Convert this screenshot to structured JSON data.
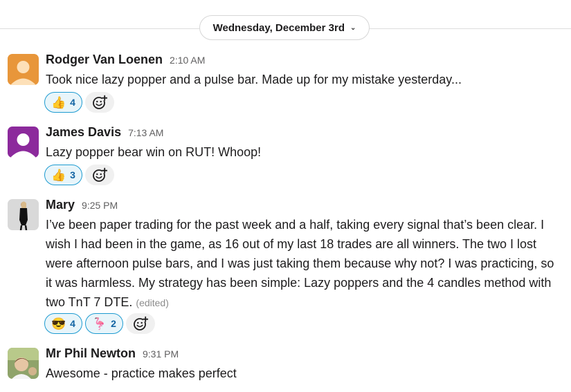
{
  "date_divider": {
    "label": "Wednesday, December 3rd"
  },
  "messages": [
    {
      "author": "Rodger Van Loenen",
      "time": "2:10 AM",
      "text": "Took nice lazy popper and a pulse bar. Made up for my mistake yesterday...",
      "reactions": [
        {
          "emoji": "👍",
          "count": "4"
        }
      ]
    },
    {
      "author": "James Davis",
      "time": "7:13 AM",
      "text": "Lazy popper bear win on RUT! Whoop!",
      "reactions": [
        {
          "emoji": "👍",
          "count": "3"
        }
      ]
    },
    {
      "author": "Mary",
      "time": "9:25 PM",
      "text": "I’ve been paper trading for the past week and a half, taking every signal that’s been clear. I wish I had been in the game, as 16 out of my last 18 trades are all winners. The two I lost were afternoon pulse bars, and I was just taking them because why not? I was practicing, so it was harmless. My strategy has been simple: Lazy poppers and the 4 candles method with two TnT 7 DTE.",
      "edited": "(edited)",
      "reactions": [
        {
          "emoji": "😎",
          "count": "4"
        },
        {
          "emoji": "🦩",
          "count": "2"
        }
      ]
    },
    {
      "author": "Mr Phil Newton",
      "time": "9:31 PM",
      "text": "Awesome - practice makes perfect"
    }
  ],
  "colors": {
    "reaction_bg": "#e8f5fa",
    "reaction_border": "#1d9bd1",
    "reaction_text": "#1264a3",
    "avatar_orange": "#e8963a",
    "avatar_purple": "#8c2a9c"
  }
}
